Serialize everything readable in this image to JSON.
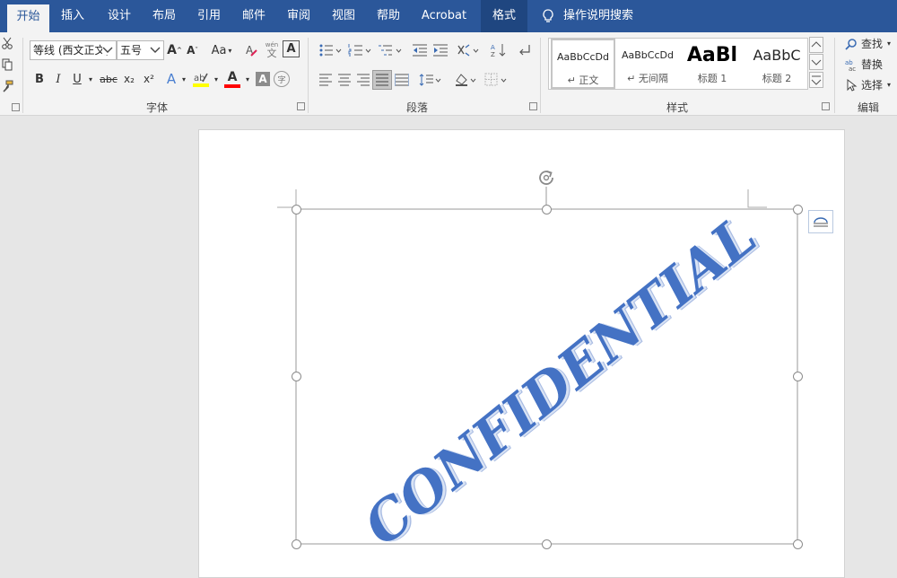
{
  "tabs": {
    "home": "开始",
    "insert": "插入",
    "design": "设计",
    "layout": "布局",
    "references": "引用",
    "mailings": "邮件",
    "review": "审阅",
    "view": "视图",
    "help": "帮助",
    "acrobat": "Acrobat",
    "format": "格式"
  },
  "tell_me": "操作说明搜索",
  "font": {
    "name": "等线 (西文正文)",
    "size": "五号",
    "change_case": "Aa",
    "group_label": "字体",
    "bold": "B",
    "italic": "I",
    "underline": "U",
    "strike": "abc",
    "subscript": "x₂",
    "superscript": "x²",
    "effects": "A",
    "char_shade": "A",
    "phonetic": "wén",
    "highlight_color": "#ffff00",
    "font_color": "#ff0000"
  },
  "paragraph": {
    "group_label": "段落"
  },
  "styles": {
    "group_label": "样式",
    "items": [
      {
        "sample": "AaBbCcDd",
        "name": "正文"
      },
      {
        "sample": "AaBbCcDd",
        "name": "无间隔"
      },
      {
        "sample": "AaBl",
        "name": "标题 1"
      },
      {
        "sample": "AaBbC",
        "name": "标题 2"
      }
    ]
  },
  "editing": {
    "find": "查找",
    "replace": "替换",
    "select": "选择",
    "group_label": "编辑"
  },
  "document": {
    "wordart_text": "CONFIDENTIAL",
    "wordart_color": "#4472c4"
  },
  "colors": {
    "ribbon_blue": "#2b579a",
    "format_tab": "#1f4680"
  }
}
